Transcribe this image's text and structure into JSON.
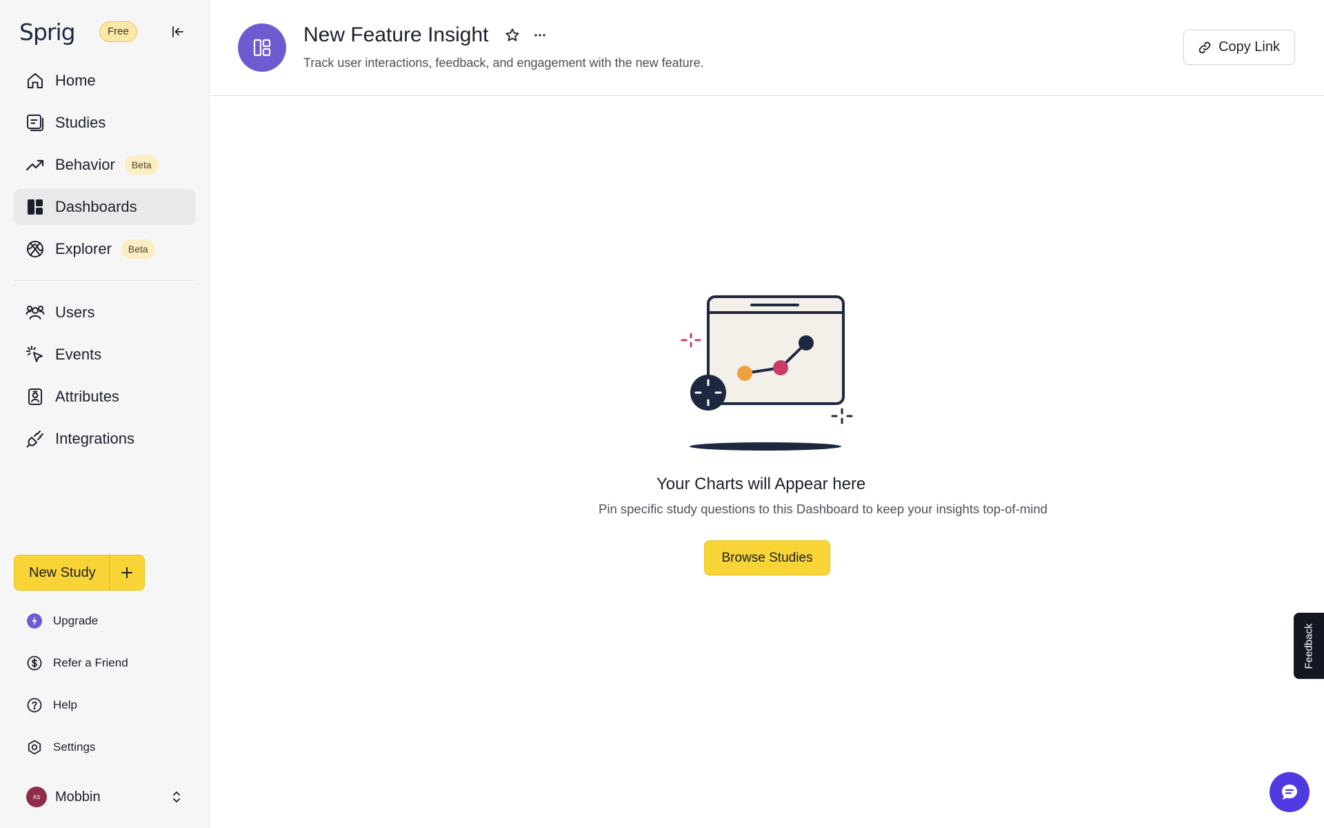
{
  "brand": {
    "logo_text": "Sprig",
    "plan_badge": "Free"
  },
  "sidebar": {
    "nav": [
      {
        "label": "Home",
        "icon": "home-icon"
      },
      {
        "label": "Studies",
        "icon": "studies-icon"
      },
      {
        "label": "Behavior",
        "icon": "trending-up-icon",
        "badge": "Beta"
      },
      {
        "label": "Dashboards",
        "icon": "dashboard-icon",
        "active": true
      },
      {
        "label": "Explorer",
        "icon": "explorer-icon",
        "badge": "Beta"
      }
    ],
    "data_nav": [
      {
        "label": "Users",
        "icon": "users-icon"
      },
      {
        "label": "Events",
        "icon": "cursor-click-icon"
      },
      {
        "label": "Attributes",
        "icon": "badge-icon"
      },
      {
        "label": "Integrations",
        "icon": "plug-icon"
      }
    ],
    "new_study_label": "New Study",
    "footer": [
      {
        "label": "Upgrade",
        "icon": "upgrade-icon"
      },
      {
        "label": "Refer a Friend",
        "icon": "dollar-icon"
      },
      {
        "label": "Help",
        "icon": "help-icon"
      },
      {
        "label": "Settings",
        "icon": "settings-icon"
      }
    ],
    "account": {
      "avatar_initials": "AS",
      "name": "Mobbin"
    }
  },
  "header": {
    "title": "New Feature Insight",
    "description": "Track user interactions, feedback, and engagement with the new feature.",
    "copy_link_label": "Copy Link"
  },
  "empty_state": {
    "title": "Your Charts will Appear here",
    "subtitle": "Pin specific study questions to this Dashboard to keep your insights top-of-mind",
    "button_label": "Browse Studies"
  },
  "feedback_tab_label": "Feedback",
  "colors": {
    "accent_yellow": "#f8d437",
    "brand_purple": "#6e5bd1",
    "chat_blue": "#4f39e0",
    "dark_navy": "#1d2840"
  }
}
